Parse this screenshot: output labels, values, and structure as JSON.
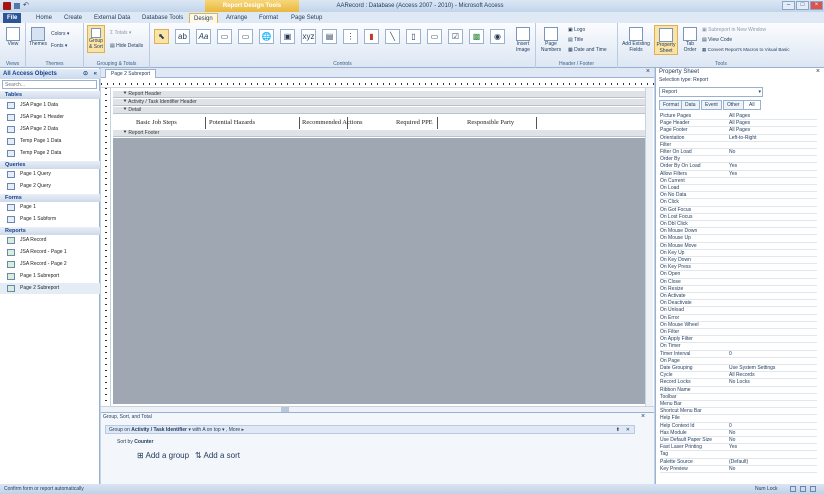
{
  "titlebar": {
    "context": "Report Design Tools",
    "title": "AARecord : Database (Access 2007 - 2010) - Microsoft Access"
  },
  "tabs": {
    "file": "File",
    "home": "Home",
    "create": "Create",
    "external": "External Data",
    "dbtools": "Database Tools",
    "design": "Design",
    "arrange": "Arrange",
    "format": "Format",
    "pagesetup": "Page Setup"
  },
  "ribbon": {
    "views": {
      "view": "View",
      "label": "Views"
    },
    "themes": {
      "themes": "Themes",
      "colors": "Colors",
      "fonts": "Fonts",
      "label": "Themes"
    },
    "grouping": {
      "group_sort": "Group & Sort",
      "totals": "Totals",
      "hide_details": "Hide Details",
      "label": "Grouping & Totals"
    },
    "controls": {
      "label": "Controls",
      "insert_image": "Insert Image"
    },
    "header_footer": {
      "page_numbers": "Page Numbers",
      "logo": "Logo",
      "title": "Title",
      "date_time": "Date and Time",
      "label": "Header / Footer"
    },
    "tools": {
      "add_fields": "Add Existing Fields",
      "property_sheet": "Property Sheet",
      "tab_order": "Tab Order",
      "subreport_new": "Subreport in New Window",
      "view_code": "View Code",
      "convert_macros": "Convert Report's Macros to Visual Basic",
      "label": "Tools"
    }
  },
  "nav": {
    "title": "All Access Objects",
    "search_placeholder": "Search...",
    "tables_label": "Tables",
    "tables": [
      "JSA Page 1 Data",
      "JSA Page 1 Header",
      "JSA Page 2 Data",
      "Temp Page 1 Data",
      "Temp Page 2 Data"
    ],
    "queries_label": "Queries",
    "queries": [
      "Page 1 Query",
      "Page 2 Query"
    ],
    "forms_label": "Forms",
    "forms": [
      "Page 1",
      "Page 1 Subform"
    ],
    "reports_label": "Reports",
    "reports": [
      "JSA Record",
      "JSA Record - Page 1",
      "JSA Record - Page 2",
      "Page 1 Subreport",
      "Page 2 Subreport"
    ]
  },
  "doc": {
    "tab": "Page 2 Subreport",
    "report_header": "Report Header",
    "page_header": "Activity / Task Identifier Header",
    "detail": "Detail",
    "report_footer": "Report Footer",
    "labels": [
      "Basic Job Steps",
      "Potential Hazards",
      "Recommended Actions",
      "Required PPE",
      "Responsible Party"
    ]
  },
  "groupsort": {
    "title": "Group, Sort, and Total",
    "group_on": "Group on",
    "field": "Activity / Task Identifier",
    "order": "with A on top",
    "more": "More",
    "sort_by": "Sort by",
    "sort_field": "Counter",
    "add_group": "Add a group",
    "add_sort": "Add a sort"
  },
  "propsheet": {
    "title": "Property Sheet",
    "selection": "Selection type:  Report",
    "object": "Report",
    "tabs": [
      "Format",
      "Data",
      "Event",
      "Other",
      "All"
    ],
    "rows": [
      [
        "Picture Pages",
        "All Pages"
      ],
      [
        "Page Header",
        "All Pages"
      ],
      [
        "Page Footer",
        "All Pages"
      ],
      [
        "Orientation",
        "Left-to-Right"
      ],
      [
        "Filter",
        ""
      ],
      [
        "Filter On Load",
        "No"
      ],
      [
        "Order By",
        ""
      ],
      [
        "Order By On Load",
        "Yes"
      ],
      [
        "Allow Filters",
        "Yes"
      ],
      [
        "On Current",
        ""
      ],
      [
        "On Load",
        ""
      ],
      [
        "On No Data",
        ""
      ],
      [
        "On Click",
        ""
      ],
      [
        "On Got Focus",
        ""
      ],
      [
        "On Lost Focus",
        ""
      ],
      [
        "On Dbl Click",
        ""
      ],
      [
        "On Mouse Down",
        ""
      ],
      [
        "On Mouse Up",
        ""
      ],
      [
        "On Mouse Move",
        ""
      ],
      [
        "On Key Up",
        ""
      ],
      [
        "On Key Down",
        ""
      ],
      [
        "On Key Press",
        ""
      ],
      [
        "On Open",
        ""
      ],
      [
        "On Close",
        ""
      ],
      [
        "On Resize",
        ""
      ],
      [
        "On Activate",
        ""
      ],
      [
        "On Deactivate",
        ""
      ],
      [
        "On Unload",
        ""
      ],
      [
        "On Error",
        ""
      ],
      [
        "On Mouse Wheel",
        ""
      ],
      [
        "On Filter",
        ""
      ],
      [
        "On Apply Filter",
        ""
      ],
      [
        "On Timer",
        ""
      ],
      [
        "Timer Interval",
        "0"
      ],
      [
        "On Page",
        ""
      ],
      [
        "Date Grouping",
        "Use System Settings"
      ],
      [
        "Cycle",
        "All Records"
      ],
      [
        "Record Locks",
        "No Locks"
      ],
      [
        "Ribbon Name",
        ""
      ],
      [
        "Toolbar",
        ""
      ],
      [
        "Menu Bar",
        ""
      ],
      [
        "Shortcut Menu Bar",
        ""
      ],
      [
        "Help File",
        ""
      ],
      [
        "Help Context Id",
        "0"
      ],
      [
        "Has Module",
        "No"
      ],
      [
        "Use Default Paper Size",
        "No"
      ],
      [
        "Fast Laser Printing",
        "Yes"
      ],
      [
        "Tag",
        ""
      ],
      [
        "Palette Source",
        "(Default)"
      ],
      [
        "Key Preview",
        "No"
      ]
    ]
  },
  "status": {
    "left": "Confirm form or report automatically",
    "numlock": "Num Lock"
  }
}
